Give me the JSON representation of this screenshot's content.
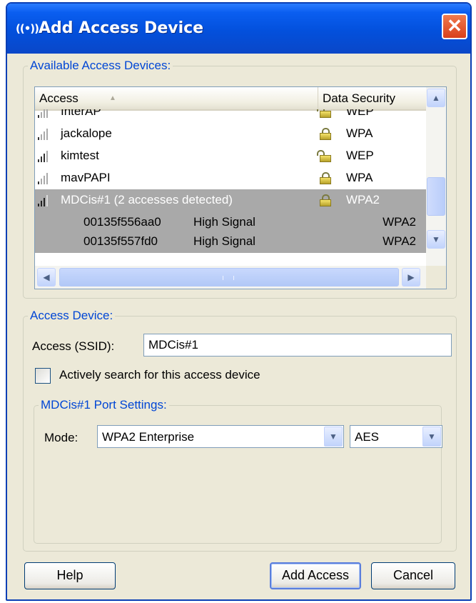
{
  "window": {
    "title": "Add Access Device",
    "close_glyph": "✕"
  },
  "available": {
    "legend": "Available Access Devices:",
    "columns": {
      "access": "Access",
      "data_security": "Data Security"
    },
    "rows": [
      {
        "name": "InterAP",
        "security": "WEP",
        "locked": false
      },
      {
        "name": "jackalope",
        "security": "WPA",
        "locked": true
      },
      {
        "name": "kimtest",
        "security": "WEP",
        "locked": false
      },
      {
        "name": "mavPAPI",
        "security": "WPA",
        "locked": true
      },
      {
        "name": "MDCis#1 (2 accesses detected)",
        "security": "WPA2",
        "locked": true,
        "selected": true
      }
    ],
    "sub_rows": [
      {
        "id": "00135f556aa0",
        "signal": "High Signal",
        "security": "WPA2"
      },
      {
        "id": "00135f557fd0",
        "signal": "High Signal",
        "security": "WPA2"
      }
    ],
    "scroll_up": "▲",
    "scroll_down": "▼",
    "scroll_left": "◀",
    "scroll_right": "▶"
  },
  "device": {
    "legend": "Access Device:",
    "ssid_label": "Access (SSID):",
    "ssid_value": "MDCis#1",
    "search_label": "Actively search for this access device",
    "search_checked": false
  },
  "port": {
    "legend": "MDCis#1 Port Settings:",
    "mode_label": "Mode:",
    "mode_value": "WPA2 Enterprise",
    "cipher_value": "AES",
    "dropdown_glyph": "▼"
  },
  "buttons": {
    "help": "Help",
    "add": "Add Access",
    "cancel": "Cancel"
  },
  "colors": {
    "title_bar": "#0350dc",
    "selection": "#a9a9a9",
    "legend_text": "#0046d5"
  }
}
